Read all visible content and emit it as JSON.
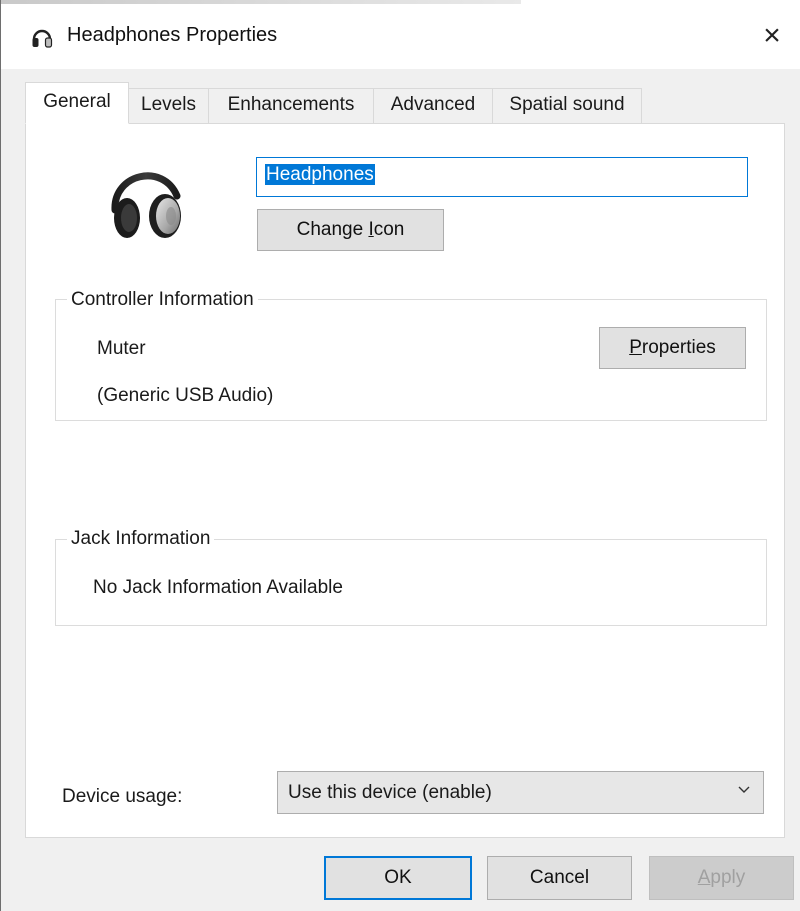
{
  "window": {
    "title": "Headphones Properties",
    "close_glyph": "×",
    "icon": "headphones-icon"
  },
  "tabs": [
    {
      "label": "General",
      "active": true
    },
    {
      "label": "Levels",
      "active": false
    },
    {
      "label": "Enhancements",
      "active": false
    },
    {
      "label": "Advanced",
      "active": false
    },
    {
      "label": "Spatial sound",
      "active": false
    }
  ],
  "general": {
    "device_name_value": "Headphones",
    "change_icon_button": {
      "pre": "Change ",
      "accel": "I",
      "post": "con"
    },
    "controller": {
      "group_label": "Controller Information",
      "name": "Muter",
      "driver": "(Generic USB Audio)",
      "properties_button": {
        "pre": "",
        "accel": "P",
        "post": "roperties"
      }
    },
    "jack": {
      "group_label": "Jack Information",
      "text": "No Jack Information Available"
    },
    "device_usage": {
      "label": "Device usage:",
      "selected": "Use this device (enable)"
    }
  },
  "footer": {
    "ok_label": "OK",
    "cancel_label": "Cancel",
    "apply_button": {
      "pre": "",
      "accel": "A",
      "post": "pply"
    }
  },
  "colors": {
    "selection": "#0078d7",
    "disabled_text": "#a0a0a0",
    "window_bg": "#f0f0f0"
  }
}
